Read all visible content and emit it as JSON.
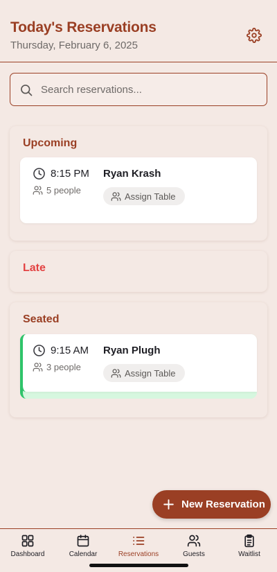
{
  "header": {
    "title": "Today's Reservations",
    "date": "Thursday, February 6, 2025"
  },
  "search": {
    "placeholder": "Search reservations..."
  },
  "colors": {
    "accent": "#9a3f24",
    "late": "#e34242",
    "seated_bar": "#2ec46a",
    "seated_tint": "#d6f7df",
    "background": "#f4e9e4"
  },
  "sections": [
    {
      "title": "Upcoming",
      "reservations": [
        {
          "time": "8:15 PM",
          "party": "5 people",
          "name": "Ryan Krash",
          "action": "Assign Table"
        }
      ]
    },
    {
      "title": "Late",
      "reservations": []
    },
    {
      "title": "Seated",
      "reservations": [
        {
          "time": "9:15 AM",
          "party": "3 people",
          "name": "Ryan Plugh",
          "action": "Assign Table"
        }
      ]
    }
  ],
  "fab": {
    "label": "New Reservation",
    "icon": "plus-icon"
  },
  "nav": {
    "items": [
      {
        "label": "Dashboard",
        "icon": "grid-icon"
      },
      {
        "label": "Calendar",
        "icon": "calendar-icon"
      },
      {
        "label": "Reservations",
        "icon": "list-icon",
        "active": true
      },
      {
        "label": "Guests",
        "icon": "users-icon"
      },
      {
        "label": "Waitlist",
        "icon": "clipboard-icon"
      }
    ]
  }
}
